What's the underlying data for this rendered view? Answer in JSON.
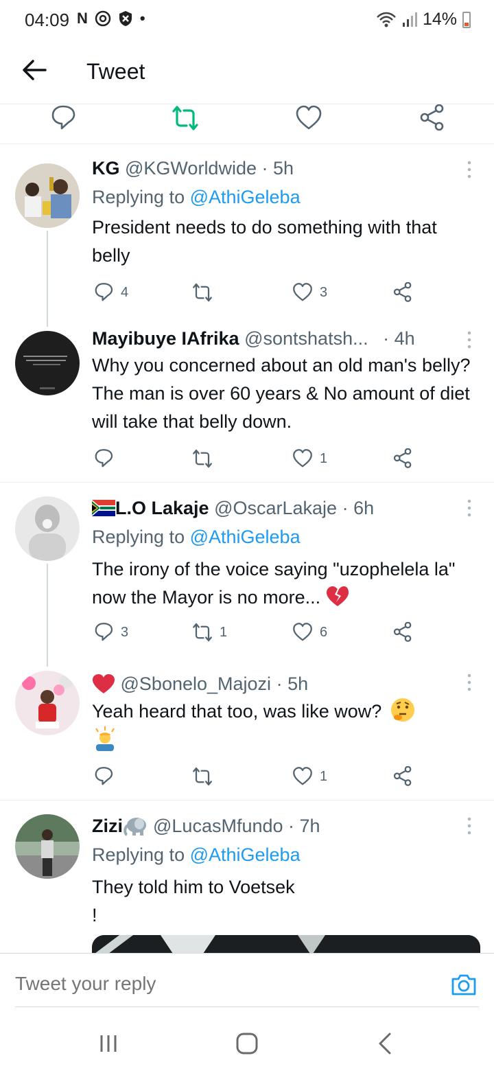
{
  "status_bar": {
    "time": "04:09",
    "battery": "14%"
  },
  "header": {
    "title": "Tweet"
  },
  "tweets": [
    {
      "name": "KG",
      "handle": "@KGWorldwide",
      "time": "· 5h",
      "replying_prefix": "Replying to ",
      "replying_to": "@AthiGeleba",
      "text": "President needs to do something with that belly",
      "replies": "4",
      "retweets": "",
      "likes": "3"
    },
    {
      "name": "Mayibuye IAfrika",
      "handle": "@sontshatsh...",
      "time": "· 4h",
      "text": "Why you concerned about an old man's belly? The man is over 60 years & No amount of diet will take that belly down.",
      "replies": "",
      "retweets": "",
      "likes": "1"
    },
    {
      "name": "L.O Lakaje",
      "handle": "@OscarLakaje",
      "time": "· 6h",
      "replying_prefix": "Replying to ",
      "replying_to": "@AthiGeleba",
      "text": "The irony of the voice saying \"uzophelela la\" now the Mayor is no more...",
      "replies": "3",
      "retweets": "1",
      "likes": "6"
    },
    {
      "name": "",
      "handle": "@Sbonelo_Majozi",
      "time": "· 5h",
      "text": "Yeah heard that too, was like wow?",
      "replies": "",
      "retweets": "",
      "likes": "1"
    },
    {
      "name": "Zizi",
      "handle": "@LucasMfundo",
      "time": "· 7h",
      "replying_prefix": "Replying to ",
      "replying_to": "@AthiGeleba",
      "text_line1": "They told him to Voetsek",
      "text_line2": "!"
    }
  ],
  "composer": {
    "placeholder": "Tweet your reply"
  },
  "colors": {
    "accent": "#1d9bf0",
    "retweet_green": "#00ba7c",
    "muted": "#536471",
    "heart_red": "#e0245e"
  }
}
